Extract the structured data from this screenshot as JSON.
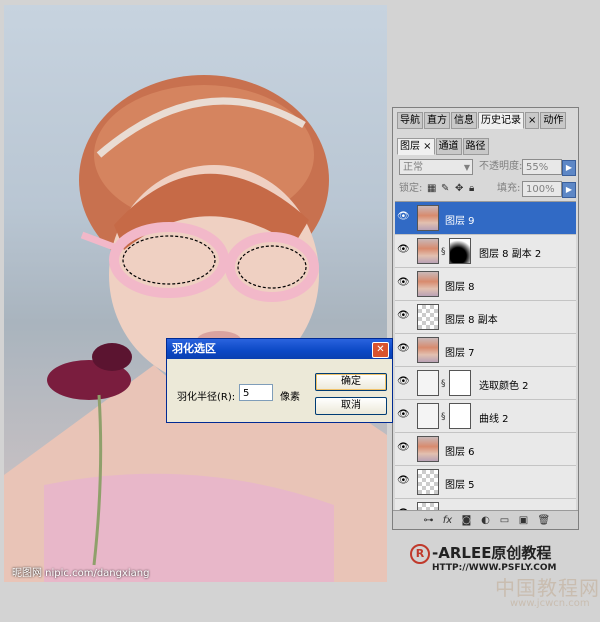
{
  "photo": {
    "watermark": "昵图网 nipic.com/dangxiang"
  },
  "panel": {
    "top_tabs": [
      {
        "label": "导航",
        "active": false
      },
      {
        "label": "直方",
        "active": false
      },
      {
        "label": "信息",
        "active": false
      },
      {
        "label": "历史记录",
        "active": true
      },
      {
        "label": "×",
        "active": false
      },
      {
        "label": "动作",
        "active": false
      }
    ],
    "sub_tabs": [
      {
        "label": "图层 ×",
        "active": true
      },
      {
        "label": "通道",
        "active": false
      },
      {
        "label": "路径",
        "active": false
      }
    ],
    "blend_mode": "正常",
    "opacity_label": "不透明度:",
    "opacity_value": "55%",
    "lock_label": "锁定:",
    "fill_label": "填充:",
    "fill_value": "100%",
    "layers": [
      {
        "name": "图层 9",
        "thumb": "photo",
        "mask": "",
        "selected": true
      },
      {
        "name": "图层 8 副本 2",
        "thumb": "photo",
        "mask": "grad",
        "selected": false
      },
      {
        "name": "图层 8",
        "thumb": "photo",
        "mask": "",
        "selected": false
      },
      {
        "name": "图层 8 副本",
        "thumb": "trans",
        "mask": "",
        "selected": false
      },
      {
        "name": "图层 7",
        "thumb": "photo",
        "mask": "",
        "selected": false
      },
      {
        "name": "选取颜色 2",
        "thumb": "adj",
        "mask": "white",
        "selected": false
      },
      {
        "name": "曲线 2",
        "thumb": "adj",
        "mask": "white",
        "selected": false
      },
      {
        "name": "图层 6",
        "thumb": "photo",
        "mask": "",
        "selected": false
      },
      {
        "name": "图层 5",
        "thumb": "trans",
        "mask": "",
        "selected": false
      },
      {
        "name": "",
        "thumb": "trans",
        "mask": "",
        "selected": false
      }
    ]
  },
  "dialog": {
    "title": "羽化选区",
    "radius_label": "羽化半径(R):",
    "radius_value": "5",
    "unit": "像素",
    "ok_label": "确定",
    "cancel_label": "取消"
  },
  "brand": {
    "name": "-ARLEE原创教程",
    "url": "HTTP://WWW.PSFLY.COM",
    "site_cn": "中国教程网",
    "site_url": "www.jcwcn.com"
  },
  "colors": {
    "selection": "#316ac5",
    "titlebar": "#0b48c5",
    "accent_brand": "#c0392b"
  }
}
